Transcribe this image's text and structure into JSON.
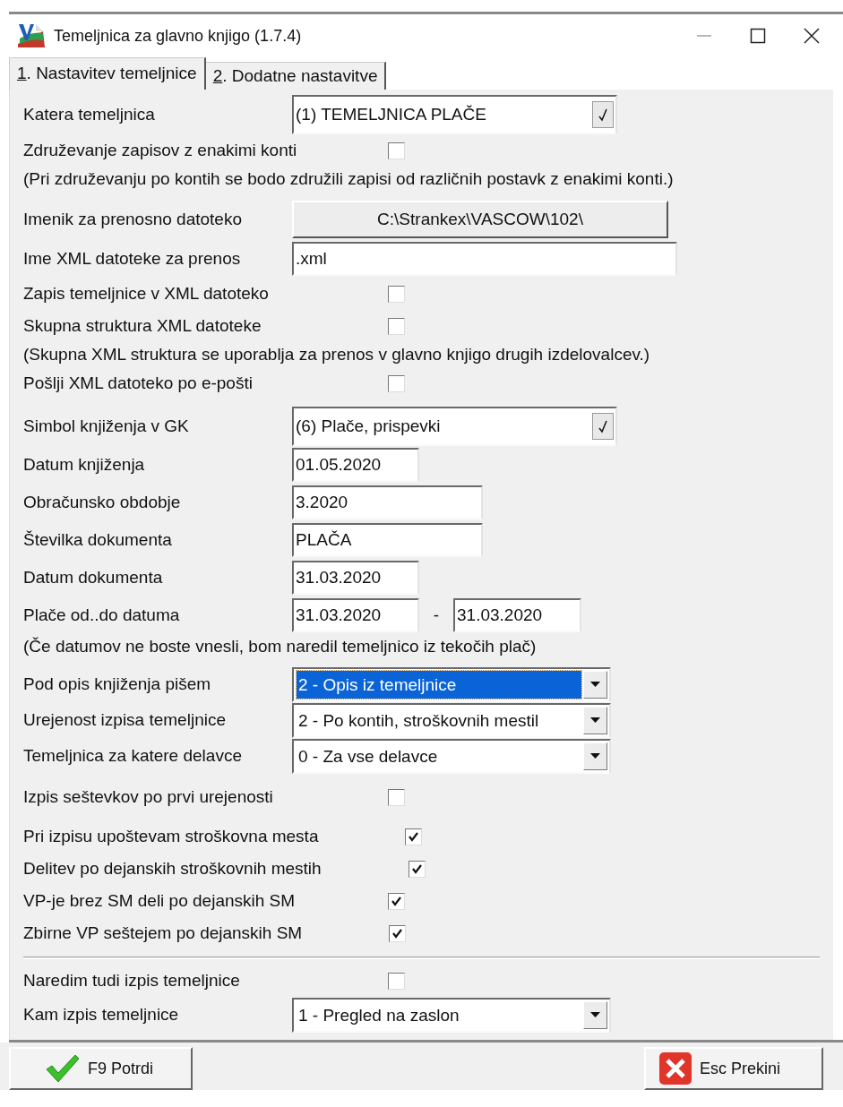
{
  "window": {
    "title": "Temeljnica za glavno knjigo  (1.7.4)"
  },
  "tabs": [
    {
      "accel": "1",
      "label": ". Nastavitev temeljnice",
      "selected": true
    },
    {
      "accel": "2",
      "label": ". Dodatne nastavitve",
      "selected": false
    }
  ],
  "sections": [
    {
      "divider_before": false,
      "rows": [
        {
          "kind": "combo",
          "label": "Katera temeljnica",
          "value": "(1) TEMELJNICA PLAČE"
        },
        {
          "kind": "checkbox",
          "label": "Združevanje zapisov z enakimi konti",
          "checked": false
        },
        {
          "kind": "note",
          "text": "(Pri združevanju po kontih se bodo združili zapisi od različnih postavk z enakimi konti.)"
        }
      ]
    },
    {
      "divider_before": false,
      "rows": [
        {
          "kind": "path_button",
          "label": "Imenik za prenosno datoteko",
          "value": "C:\\Strankex\\VASCOW\\102\\"
        },
        {
          "kind": "text",
          "label": "Ime XML datoteke za prenos",
          "value": ".xml"
        },
        {
          "kind": "checkbox",
          "label": "Zapis temeljnice v XML datoteko",
          "checked": false
        },
        {
          "kind": "checkbox",
          "label": "Skupna struktura XML datoteke",
          "checked": false
        },
        {
          "kind": "note",
          "text": "(Skupna XML struktura se uporablja za prenos v glavno knjigo drugih izdelovalcev.)"
        },
        {
          "kind": "checkbox",
          "label": "Pošlji XML datoteko po e-pošti",
          "checked": false
        }
      ]
    },
    {
      "divider_before": false,
      "rows": [
        {
          "kind": "combo",
          "label": "Simbol knjiženja v GK",
          "value": "(6) Plače, prispevki"
        },
        {
          "kind": "text",
          "label": "Datum knjiženja",
          "value": "01.05.2020"
        },
        {
          "kind": "text",
          "label": "Obračunsko obdobje",
          "value": "3.2020"
        },
        {
          "kind": "text",
          "label": "Številka dokumenta",
          "value": "PLAČA"
        },
        {
          "kind": "text",
          "label": "Datum dokumenta",
          "value": "31.03.2020"
        },
        {
          "kind": "range",
          "label": "Plače od..do datuma",
          "from": "31.03.2020",
          "separator": "-",
          "to": "31.03.2020"
        },
        {
          "kind": "note",
          "text": "(Če datumov ne boste vnesli, bom naredil temeljnico iz tekočih plač)"
        }
      ]
    },
    {
      "divider_before": false,
      "rows": [
        {
          "kind": "dropdown",
          "label": "Pod opis knjiženja pišem",
          "value": "2 - Opis iz temeljnice",
          "selected": true
        },
        {
          "kind": "dropdown",
          "label": "Urejenost izpisa temeljnice",
          "value": "2 - Po kontih, stroškovnih mestil",
          "selected": false
        },
        {
          "kind": "dropdown",
          "label": "Temeljnica za katere delavce",
          "value": "0 - Za vse delavce",
          "selected": false
        }
      ]
    },
    {
      "divider_before": false,
      "rows": [
        {
          "kind": "checkbox",
          "label": "Izpis seštevkov po prvi urejenosti",
          "checked": false
        }
      ]
    },
    {
      "divider_before": false,
      "rows": [
        {
          "kind": "checkbox",
          "label": "Pri izpisu upoštevam stroškovna mesta",
          "checked": true
        },
        {
          "kind": "checkbox",
          "label": "Delitev po dejanskih stroškovnih mestih",
          "checked": true
        },
        {
          "kind": "checkbox",
          "label": "VP-je brez SM deli po dejanskih SM",
          "checked": true
        },
        {
          "kind": "checkbox",
          "label": "Zbirne VP seštejem po dejanskih SM",
          "checked": true
        }
      ]
    },
    {
      "divider_before": true,
      "rows": [
        {
          "kind": "checkbox",
          "label": "Naredim tudi izpis temeljnice",
          "checked": false
        },
        {
          "kind": "dropdown",
          "label": "Kam izpis temeljnice",
          "value": "1 - Pregled na zaslon",
          "selected": false
        }
      ]
    }
  ],
  "buttons": [
    {
      "kind": "confirm",
      "label": "F9 Potrdi"
    },
    {
      "kind": "cancel",
      "label": "Esc Prekini"
    }
  ]
}
